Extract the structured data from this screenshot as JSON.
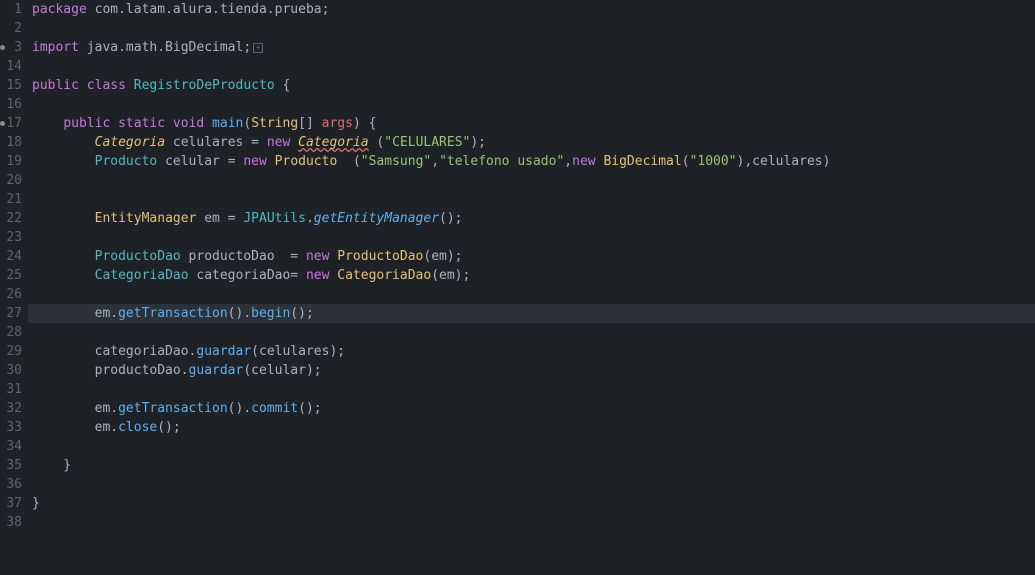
{
  "lines": [
    {
      "num": "1",
      "tokens": [
        {
          "t": "package",
          "c": "kw"
        },
        {
          "t": " ",
          "c": "pun"
        },
        {
          "t": "com.latam.alura.tienda.prueba",
          "c": "pun"
        },
        {
          "t": ";",
          "c": "pun"
        }
      ]
    },
    {
      "num": "2",
      "tokens": []
    },
    {
      "num": "3",
      "marker": true,
      "tokens": [
        {
          "t": "import",
          "c": "kw"
        },
        {
          "t": " java.math.BigDecimal;",
          "c": "pun"
        },
        {
          "t": "⊞",
          "c": "fold"
        }
      ]
    },
    {
      "num": "14",
      "tokens": []
    },
    {
      "num": "15",
      "tokens": [
        {
          "t": "public",
          "c": "kw"
        },
        {
          "t": " ",
          "c": "pun"
        },
        {
          "t": "class",
          "c": "kw"
        },
        {
          "t": " ",
          "c": "pun"
        },
        {
          "t": "RegistroDeProducto",
          "c": "type2"
        },
        {
          "t": " {",
          "c": "pun"
        }
      ]
    },
    {
      "num": "16",
      "tokens": []
    },
    {
      "num": "17",
      "marker": true,
      "tokens": [
        {
          "t": "    ",
          "c": "pun"
        },
        {
          "t": "public",
          "c": "kw"
        },
        {
          "t": " ",
          "c": "pun"
        },
        {
          "t": "static",
          "c": "kw"
        },
        {
          "t": " ",
          "c": "pun"
        },
        {
          "t": "void",
          "c": "kw"
        },
        {
          "t": " ",
          "c": "pun"
        },
        {
          "t": "main",
          "c": "method"
        },
        {
          "t": "(",
          "c": "pun"
        },
        {
          "t": "String",
          "c": "cls"
        },
        {
          "t": "[] ",
          "c": "pun"
        },
        {
          "t": "args",
          "c": "var"
        },
        {
          "t": ") {",
          "c": "pun"
        }
      ]
    },
    {
      "num": "18",
      "tokens": [
        {
          "t": "        ",
          "c": "pun"
        },
        {
          "t": "Categoria",
          "c": "cls italic"
        },
        {
          "t": " ",
          "c": "pun"
        },
        {
          "t": "celulares",
          "c": "pun"
        },
        {
          "t": " = ",
          "c": "pun"
        },
        {
          "t": "new",
          "c": "kw"
        },
        {
          "t": " ",
          "c": "pun"
        },
        {
          "t": "Categoria",
          "c": "cls italic underline-wavy"
        },
        {
          "t": " (",
          "c": "pun"
        },
        {
          "t": "\"CELULARES\"",
          "c": "str"
        },
        {
          "t": ");",
          "c": "pun"
        }
      ]
    },
    {
      "num": "19",
      "tokens": [
        {
          "t": "        ",
          "c": "pun"
        },
        {
          "t": "Producto",
          "c": "type2"
        },
        {
          "t": " ",
          "c": "pun"
        },
        {
          "t": "celular",
          "c": "pun"
        },
        {
          "t": " = ",
          "c": "pun"
        },
        {
          "t": "new",
          "c": "kw"
        },
        {
          "t": " ",
          "c": "pun"
        },
        {
          "t": "Producto",
          "c": "cls"
        },
        {
          "t": "  (",
          "c": "pun"
        },
        {
          "t": "\"Samsung\"",
          "c": "str"
        },
        {
          "t": ",",
          "c": "pun"
        },
        {
          "t": "\"telefono usado\"",
          "c": "str"
        },
        {
          "t": ",",
          "c": "pun"
        },
        {
          "t": "new",
          "c": "kw"
        },
        {
          "t": " ",
          "c": "pun"
        },
        {
          "t": "BigDecimal",
          "c": "cls"
        },
        {
          "t": "(",
          "c": "pun"
        },
        {
          "t": "\"1000\"",
          "c": "str"
        },
        {
          "t": "),",
          "c": "pun"
        },
        {
          "t": "celulares",
          "c": "pun"
        },
        {
          "t": ")",
          "c": "pun"
        }
      ]
    },
    {
      "num": "20",
      "tokens": []
    },
    {
      "num": "21",
      "tokens": []
    },
    {
      "num": "22",
      "tokens": [
        {
          "t": "        ",
          "c": "pun"
        },
        {
          "t": "EntityManager",
          "c": "cls"
        },
        {
          "t": " ",
          "c": "pun"
        },
        {
          "t": "em",
          "c": "pun"
        },
        {
          "t": " = ",
          "c": "pun"
        },
        {
          "t": "JPAUtils",
          "c": "type2"
        },
        {
          "t": ".",
          "c": "pun"
        },
        {
          "t": "getEntityManager",
          "c": "method-italic"
        },
        {
          "t": "();",
          "c": "pun"
        }
      ]
    },
    {
      "num": "23",
      "tokens": []
    },
    {
      "num": "24",
      "tokens": [
        {
          "t": "        ",
          "c": "pun"
        },
        {
          "t": "ProductoDao",
          "c": "type2"
        },
        {
          "t": " ",
          "c": "pun"
        },
        {
          "t": "productoDao",
          "c": "pun"
        },
        {
          "t": "  = ",
          "c": "pun"
        },
        {
          "t": "new",
          "c": "kw"
        },
        {
          "t": " ",
          "c": "pun"
        },
        {
          "t": "ProductoDao",
          "c": "cls"
        },
        {
          "t": "(",
          "c": "pun"
        },
        {
          "t": "em",
          "c": "pun"
        },
        {
          "t": ");",
          "c": "pun"
        }
      ]
    },
    {
      "num": "25",
      "tokens": [
        {
          "t": "        ",
          "c": "pun"
        },
        {
          "t": "CategoriaDao",
          "c": "type2"
        },
        {
          "t": " ",
          "c": "pun"
        },
        {
          "t": "categoriaDao",
          "c": "pun"
        },
        {
          "t": "= ",
          "c": "pun"
        },
        {
          "t": "new",
          "c": "kw"
        },
        {
          "t": " ",
          "c": "pun"
        },
        {
          "t": "CategoriaDao",
          "c": "cls"
        },
        {
          "t": "(",
          "c": "pun"
        },
        {
          "t": "em",
          "c": "pun"
        },
        {
          "t": ");",
          "c": "pun"
        }
      ]
    },
    {
      "num": "26",
      "tokens": []
    },
    {
      "num": "27",
      "highlight": true,
      "tokens": [
        {
          "t": "        em.",
          "c": "pun"
        },
        {
          "t": "getTransaction",
          "c": "method"
        },
        {
          "t": "().",
          "c": "pun"
        },
        {
          "t": "begin",
          "c": "method"
        },
        {
          "t": "();",
          "c": "pun"
        }
      ]
    },
    {
      "num": "28",
      "tokens": []
    },
    {
      "num": "29",
      "tokens": [
        {
          "t": "        categoriaDao.",
          "c": "pun"
        },
        {
          "t": "guardar",
          "c": "method"
        },
        {
          "t": "(",
          "c": "pun"
        },
        {
          "t": "celulares",
          "c": "pun"
        },
        {
          "t": ");",
          "c": "pun"
        }
      ]
    },
    {
      "num": "30",
      "tokens": [
        {
          "t": "        productoDao.",
          "c": "pun"
        },
        {
          "t": "guardar",
          "c": "method"
        },
        {
          "t": "(",
          "c": "pun"
        },
        {
          "t": "celular",
          "c": "pun"
        },
        {
          "t": ");",
          "c": "pun"
        }
      ]
    },
    {
      "num": "31",
      "tokens": []
    },
    {
      "num": "32",
      "tokens": [
        {
          "t": "        em.",
          "c": "pun"
        },
        {
          "t": "getTransaction",
          "c": "method"
        },
        {
          "t": "().",
          "c": "pun"
        },
        {
          "t": "commit",
          "c": "method"
        },
        {
          "t": "();",
          "c": "pun"
        }
      ]
    },
    {
      "num": "33",
      "tokens": [
        {
          "t": "        em.",
          "c": "pun"
        },
        {
          "t": "close",
          "c": "method"
        },
        {
          "t": "();",
          "c": "pun"
        }
      ]
    },
    {
      "num": "34",
      "tokens": []
    },
    {
      "num": "35",
      "tokens": [
        {
          "t": "    }",
          "c": "pun"
        }
      ]
    },
    {
      "num": "36",
      "tokens": []
    },
    {
      "num": "37",
      "tokens": [
        {
          "t": "}",
          "c": "pun"
        }
      ]
    },
    {
      "num": "38",
      "tokens": []
    }
  ]
}
